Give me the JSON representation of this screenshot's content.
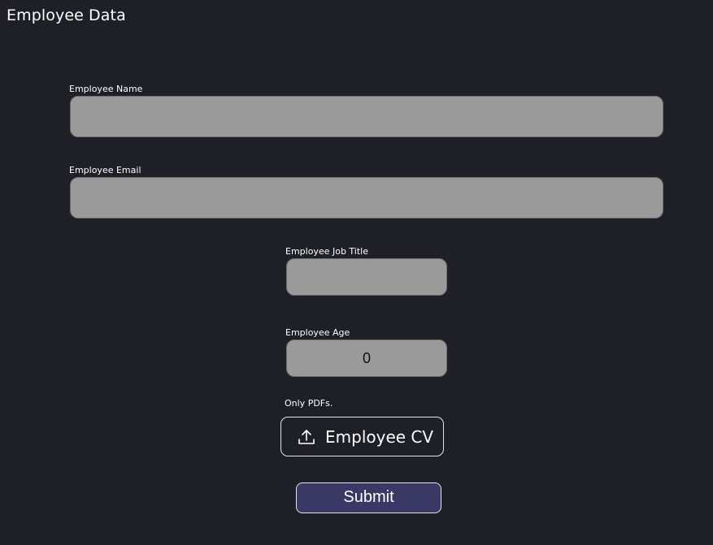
{
  "page": {
    "title": "Employee Data"
  },
  "form": {
    "name": {
      "label": "Employee Name",
      "value": ""
    },
    "email": {
      "label": "Employee Email",
      "value": ""
    },
    "job_title": {
      "label": "Employee Job Title",
      "value": ""
    },
    "age": {
      "label": "Employee Age",
      "value": "0"
    },
    "cv": {
      "hint": "Only PDFs.",
      "button_label": "Employee CV",
      "icon": "upload-icon"
    },
    "submit_label": "Submit"
  },
  "colors": {
    "background": "#1e1f27",
    "field_fill": "#9a9a9a",
    "submit_fill": "#3a3965",
    "border_light": "#e6e6e6"
  }
}
